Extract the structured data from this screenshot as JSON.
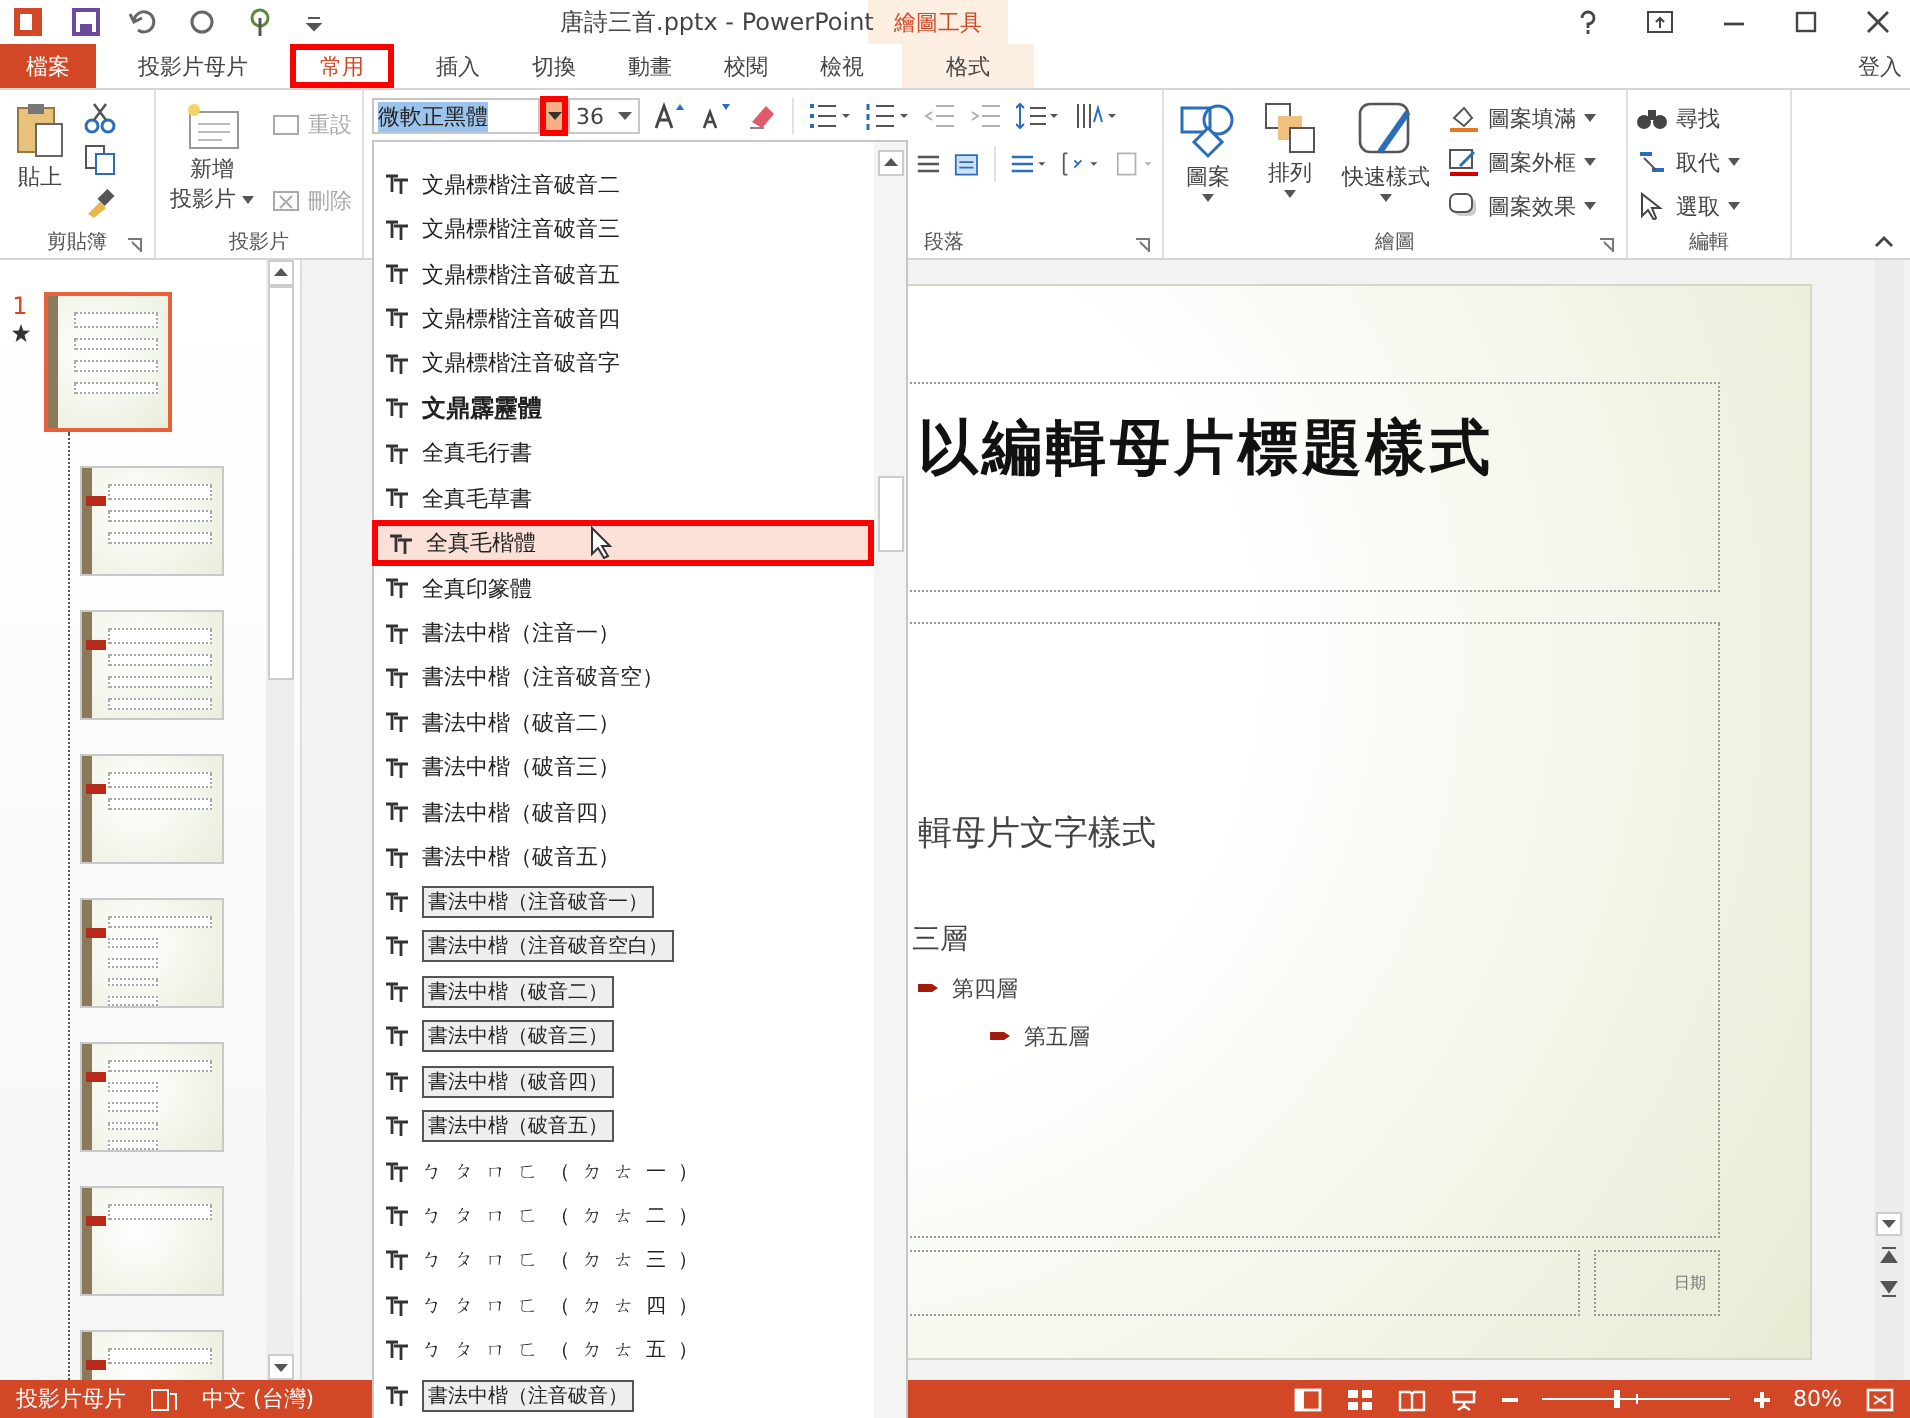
{
  "window": {
    "title": "唐詩三首.pptx - PowerPoint",
    "contextual_group": "繪圖工具",
    "sign_in": "登入"
  },
  "tabs": [
    {
      "label": "檔案",
      "kind": "file",
      "selected": false,
      "highlighted": false
    },
    {
      "label": "投影片母片",
      "kind": "normal",
      "selected": false,
      "highlighted": false
    },
    {
      "label": "常用",
      "kind": "normal",
      "selected": true,
      "highlighted": true
    },
    {
      "label": "插入",
      "kind": "normal",
      "selected": false,
      "highlighted": false
    },
    {
      "label": "切換",
      "kind": "normal",
      "selected": false,
      "highlighted": false
    },
    {
      "label": "動畫",
      "kind": "normal",
      "selected": false,
      "highlighted": false
    },
    {
      "label": "校閱",
      "kind": "normal",
      "selected": false,
      "highlighted": false
    },
    {
      "label": "檢視",
      "kind": "normal",
      "selected": false,
      "highlighted": false
    },
    {
      "label": "格式",
      "kind": "contextual",
      "selected": false,
      "highlighted": false
    }
  ],
  "clipboard": {
    "label": "剪貼簿",
    "paste": "貼上"
  },
  "slides_group": {
    "label": "投影片",
    "new_slide": [
      "新增",
      "投影片"
    ],
    "reset": "重設",
    "delete": "刪除"
  },
  "font": {
    "name": "微軟正黑體",
    "size": "36",
    "arrow_highlighted": true
  },
  "paragraph": {
    "label": "段落"
  },
  "drawing": {
    "label": "繪圖",
    "shapes": "圖案",
    "arrange": "排列",
    "quick_styles": "快速樣式",
    "fill": "圖案填滿",
    "outline": "圖案外框",
    "effects": "圖案效果"
  },
  "editing": {
    "label": "編輯",
    "find": "尋找",
    "replace": "取代",
    "select": "選取"
  },
  "font_list": [
    {
      "name": "文鼎標楷注音破音二",
      "kind": "plain",
      "selected": false
    },
    {
      "name": "文鼎標楷注音破音三",
      "kind": "plain",
      "selected": false
    },
    {
      "name": "文鼎標楷注音破音五",
      "kind": "plain",
      "selected": false
    },
    {
      "name": "文鼎標楷注音破音四",
      "kind": "plain",
      "selected": false
    },
    {
      "name": "文鼎標楷注音破音字",
      "kind": "plain",
      "selected": false
    },
    {
      "name": "文鼎霹靂體",
      "kind": "bold",
      "selected": false
    },
    {
      "name": "全真毛行書",
      "kind": "plain",
      "selected": false
    },
    {
      "name": "全真毛草書",
      "kind": "plain",
      "selected": false
    },
    {
      "name": "全真毛楷體",
      "kind": "plain",
      "selected": true
    },
    {
      "name": "全真印篆體",
      "kind": "plain",
      "selected": false
    },
    {
      "name": "書法中楷（注音一）",
      "kind": "plain",
      "selected": false
    },
    {
      "name": "書法中楷（注音破音空）",
      "kind": "plain",
      "selected": false
    },
    {
      "name": "書法中楷（破音二）",
      "kind": "plain",
      "selected": false
    },
    {
      "name": "書法中楷（破音三）",
      "kind": "plain",
      "selected": false
    },
    {
      "name": "書法中楷（破音四）",
      "kind": "plain",
      "selected": false
    },
    {
      "name": "書法中楷（破音五）",
      "kind": "plain",
      "selected": false
    },
    {
      "name": "書法中楷（注音破音一）",
      "kind": "boxed",
      "selected": false
    },
    {
      "name": "書法中楷（注音破音空白）",
      "kind": "boxed",
      "selected": false
    },
    {
      "name": "書法中楷（破音二）",
      "kind": "boxed",
      "selected": false
    },
    {
      "name": "書法中楷（破音三）",
      "kind": "boxed",
      "selected": false
    },
    {
      "name": "書法中楷（破音四）",
      "kind": "boxed",
      "selected": false
    },
    {
      "name": "書法中楷（破音五）",
      "kind": "boxed",
      "selected": false
    },
    {
      "name": "ㄅㄆㄇㄈ（ㄉㄊ一）",
      "kind": "sparse",
      "selected": false
    },
    {
      "name": "ㄅㄆㄇㄈ（ㄉㄊ二）",
      "kind": "sparse",
      "selected": false
    },
    {
      "name": "ㄅㄆㄇㄈ（ㄉㄊ三）",
      "kind": "sparse",
      "selected": false
    },
    {
      "name": "ㄅㄆㄇㄈ（ㄉㄊ四）",
      "kind": "sparse",
      "selected": false
    },
    {
      "name": "ㄅㄆㄇㄈ（ㄉㄊ五）",
      "kind": "sparse",
      "selected": false
    },
    {
      "name": "書法中楷（注音破音）",
      "kind": "boxed",
      "selected": false
    }
  ],
  "thumbnails": {
    "number": "1",
    "items": [
      {
        "kind": "title",
        "selected": true
      },
      {
        "kind": "section",
        "selected": false
      },
      {
        "kind": "content",
        "selected": false
      },
      {
        "kind": "title_only",
        "selected": false
      },
      {
        "kind": "two",
        "selected": false
      },
      {
        "kind": "comparison",
        "selected": false
      },
      {
        "kind": "blank",
        "selected": false
      },
      {
        "kind": "blank",
        "selected": false
      }
    ]
  },
  "slide": {
    "title": "以編輯母片標題樣式",
    "body": [
      {
        "text": "輯母片文字樣式",
        "kind": "level1"
      },
      {
        "text": "三層",
        "kind": "level3"
      },
      {
        "text": "第四層",
        "kind": "level4"
      },
      {
        "text": "第五層",
        "kind": "level5"
      }
    ],
    "date": "日期"
  },
  "status_bar": {
    "view": "投影片母片",
    "language": "中文 (台灣)",
    "zoom": "80%",
    "level": 0.4
  }
}
